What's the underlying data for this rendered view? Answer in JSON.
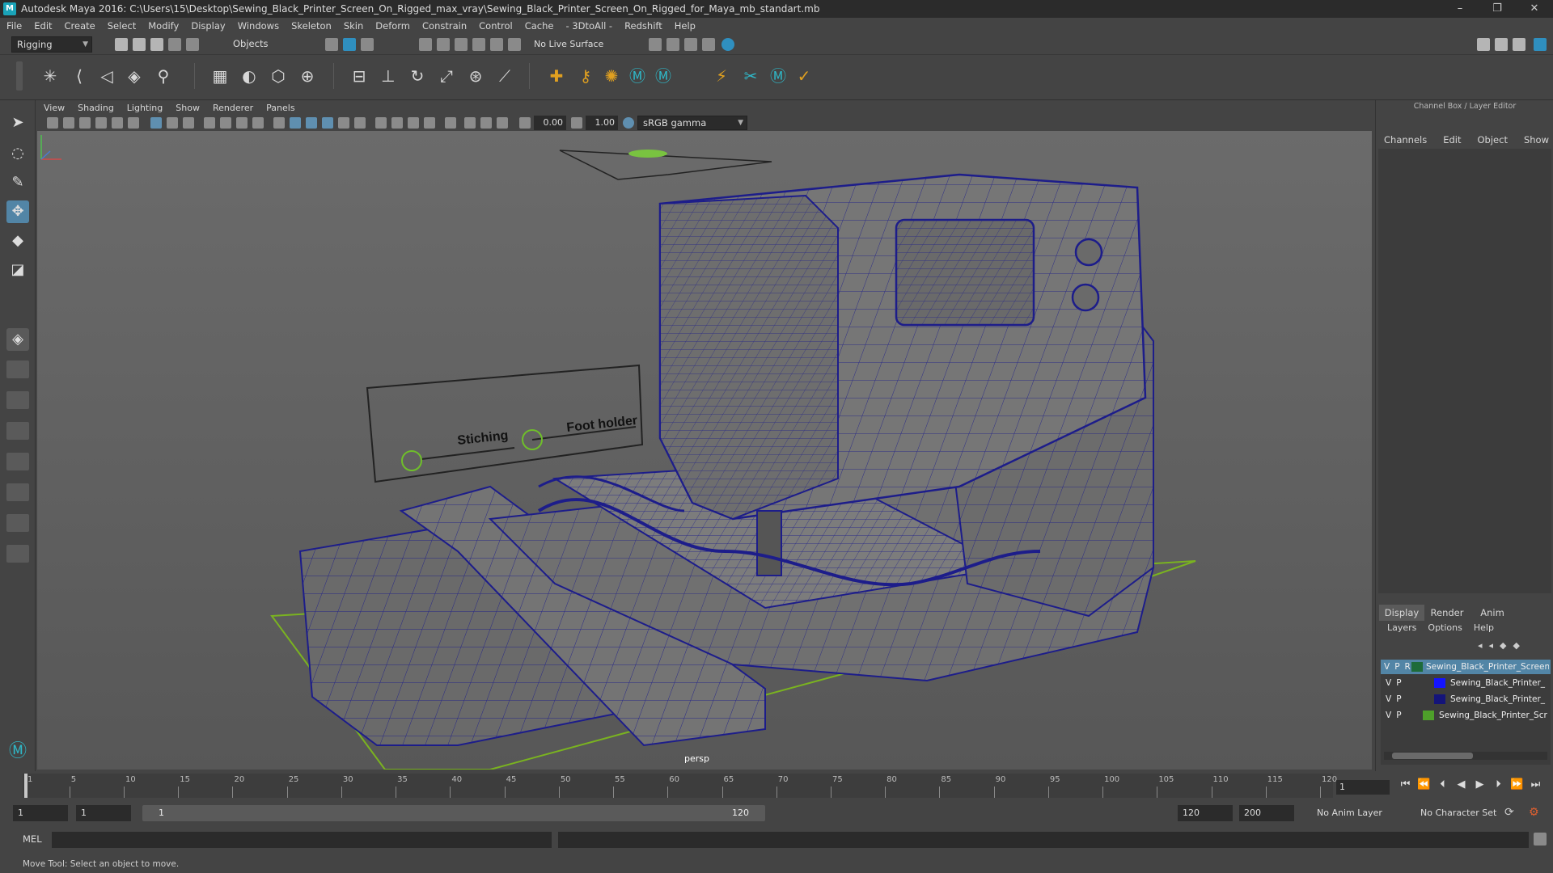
{
  "window": {
    "title": "Autodesk Maya 2016: C:\\Users\\15\\Desktop\\Sewing_Black_Printer_Screen_On_Rigged_max_vray\\Sewing_Black_Printer_Screen_On_Rigged_for_Maya_mb_standart.mb",
    "controls": [
      "–",
      "❐",
      "✕"
    ]
  },
  "menus": [
    "File",
    "Edit",
    "Create",
    "Select",
    "Modify",
    "Display",
    "Windows",
    "Skeleton",
    "Skin",
    "Deform",
    "Constrain",
    "Control",
    "Cache",
    "- 3DtoAll -",
    "Redshift",
    "Help"
  ],
  "statusline": {
    "menuset": "Rigging",
    "select_mode": "Objects",
    "live_surface": "No Live Surface"
  },
  "panel": {
    "menus": [
      "View",
      "Shading",
      "Lighting",
      "Show",
      "Renderer",
      "Panels"
    ],
    "exposure": "0.00",
    "gamma": "1.00",
    "color_space": "sRGB gamma",
    "camera_label": "persp"
  },
  "scene": {
    "control_labels": [
      "Stiching",
      "Foot holder"
    ]
  },
  "channel_box": {
    "title": "Channel Box / Layer Editor",
    "menus": [
      "Channels",
      "Edit",
      "Object",
      "Show"
    ]
  },
  "layer_editor": {
    "tabs": [
      "Display",
      "Render",
      "Anim"
    ],
    "menus": [
      "Layers",
      "Options",
      "Help"
    ],
    "layers": [
      {
        "v": "V",
        "p": "P",
        "r": "R",
        "name": "Sewing_Black_Printer_Screen",
        "color": "#1e6b3a"
      },
      {
        "v": "V",
        "p": "P",
        "r": "",
        "name": "Sewing_Black_Printer_",
        "color": "#1414ff"
      },
      {
        "v": "V",
        "p": "P",
        "r": "",
        "name": "Sewing_Black_Printer_",
        "color": "#14147a"
      },
      {
        "v": "V",
        "p": "P",
        "r": "",
        "name": "Sewing_Black_Printer_Scr",
        "color": "#4ea02a"
      }
    ]
  },
  "timeline": {
    "ticks": [
      "1",
      "5",
      "10",
      "15",
      "20",
      "25",
      "30",
      "35",
      "40",
      "45",
      "50",
      "55",
      "60",
      "65",
      "70",
      "75",
      "80",
      "85",
      "90",
      "95",
      "100",
      "105",
      "110",
      "115",
      "120"
    ],
    "current_frame": "1"
  },
  "range": {
    "start": "1",
    "playback_start": "1",
    "slider_start": "1",
    "slider_end": "120",
    "playback_end": "120",
    "end": "200",
    "anim_layer": "No Anim Layer",
    "character_set": "No Character Set"
  },
  "cmdline": {
    "lang": "MEL"
  },
  "helpline": {
    "text": "Move Tool: Select an object to move."
  }
}
